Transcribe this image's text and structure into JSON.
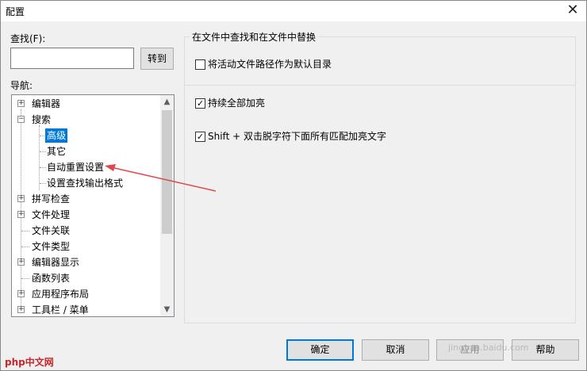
{
  "window": {
    "title": "配置"
  },
  "find": {
    "label": "查找(F):",
    "value": "",
    "goto_label": "转到"
  },
  "nav": {
    "label": "导航:",
    "items": [
      {
        "label": "编辑器",
        "expander": "+"
      },
      {
        "label": "搜索",
        "expander": "−"
      },
      {
        "label": "高级",
        "selected": true
      },
      {
        "label": "其它"
      },
      {
        "label": "自动重置设置"
      },
      {
        "label": "设置查找输出格式"
      },
      {
        "label": "拼写检查",
        "expander": "+"
      },
      {
        "label": "文件处理",
        "expander": "+"
      },
      {
        "label": "文件关联"
      },
      {
        "label": "文件类型"
      },
      {
        "label": "编辑器显示",
        "expander": "+"
      },
      {
        "label": "函数列表"
      },
      {
        "label": "应用程序布局",
        "expander": "+"
      },
      {
        "label": "工具栏 / 菜单",
        "expander": "+"
      }
    ]
  },
  "group": {
    "title": "在文件中查找和在文件中替换",
    "options": [
      {
        "label": "将活动文件路径作为默认目录",
        "checked": false
      },
      {
        "label": "持续全部加亮",
        "checked": true
      },
      {
        "label": "Shift + 双击脱字符下面所有匹配加亮文字",
        "checked": true
      }
    ]
  },
  "buttons": {
    "ok": "确定",
    "cancel": "取消",
    "apply": "应用",
    "help": "帮助"
  },
  "watermark": {
    "logo": "php中文网",
    "url": "jingyan.baidu.com"
  },
  "colors": {
    "selection": "#0078d7",
    "annotation_arrow": "#e0474c",
    "default_button_border": "#0078d7"
  }
}
